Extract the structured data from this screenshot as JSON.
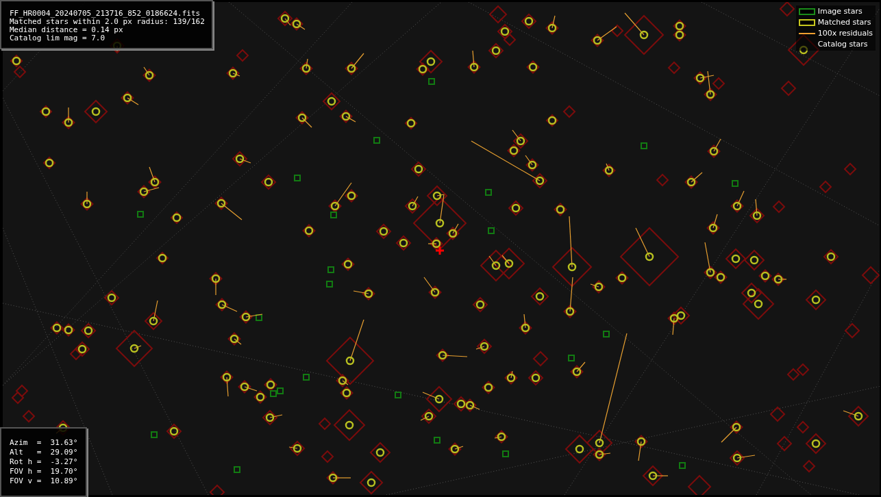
{
  "info_box": {
    "lines": [
      "FF_HR0004_20240705_213716_852_0186624.fits",
      "Matched stars within 2.0 px radius: 139/162",
      "Median distance = 0.14 px",
      "Catalog lim mag = 7.0"
    ]
  },
  "legend": [
    {
      "kind": "box",
      "color": "#1a8c1a",
      "label": "Image stars"
    },
    {
      "kind": "box",
      "color": "#c8c81e",
      "label": "Matched stars"
    },
    {
      "kind": "line",
      "color": "#f0a030",
      "label": "100x residuals"
    },
    {
      "kind": "none",
      "label": "Catalog stars"
    }
  ],
  "pointing_box": {
    "lines": [
      "Azim  =  31.63°",
      "Alt   =  29.09°",
      "Rot h =  -3.27°",
      "FOV h =  19.70°",
      "FOV v =  10.89°"
    ]
  }
}
